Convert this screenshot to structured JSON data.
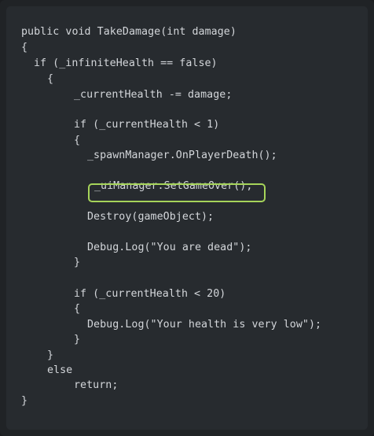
{
  "code": {
    "lines": [
      "public void TakeDamage(int damage)",
      "{",
      "if (_infiniteHealth == false)",
      "{",
      "_currentHealth -= damage;",
      "if (_currentHealth < 1)",
      "{",
      "_spawnManager.OnPlayerDeath();",
      "_uiManager.SetGameOver();",
      "Destroy(gameObject);",
      "Debug.Log(\"You are dead\");",
      "}",
      "if (_currentHealth < 20)",
      "{",
      "Debug.Log(\"Your health is very low\");",
      "}",
      "}",
      "else",
      "return;",
      "}"
    ],
    "highlighted_line": "_uiManager.SetGameOver();",
    "highlight_color": "#a6d45a",
    "text_color": "#d3d6da",
    "background_color": "#272b2f"
  }
}
